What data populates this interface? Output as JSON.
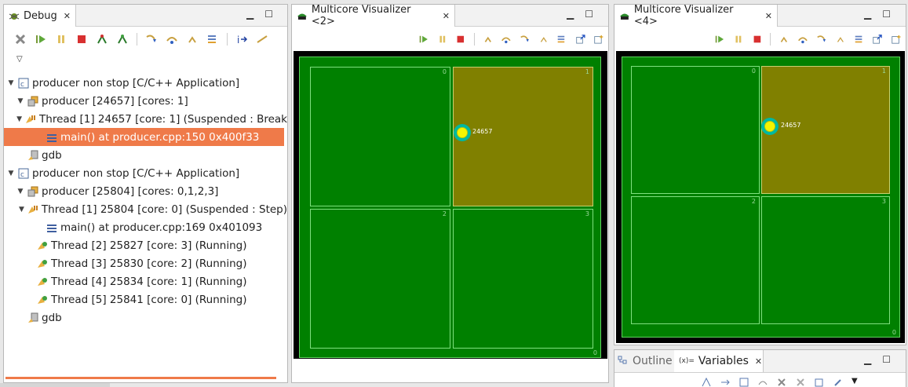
{
  "debug_view": {
    "tab_title": "Debug",
    "tree": [
      {
        "label": "producer non stop [C/C++ Application]",
        "icon": "launch-config-icon",
        "indent": 0,
        "twisty": "open"
      },
      {
        "label": "producer [24657] [cores: 1]",
        "icon": "process-icon",
        "indent": 1,
        "twisty": "open"
      },
      {
        "label": "Thread [1] 24657 [core: 1] (Suspended : Break",
        "icon": "thread-suspended-icon",
        "indent": 2,
        "twisty": "open"
      },
      {
        "label": "main() at producer.cpp:150 0x400f33",
        "icon": "stack-frame-icon",
        "indent": 3,
        "twisty": "none",
        "selected": true
      },
      {
        "label": "gdb",
        "icon": "gdb-icon",
        "indent": 1,
        "twisty": "none"
      },
      {
        "label": "producer non stop [C/C++ Application]",
        "icon": "launch-config-icon",
        "indent": 0,
        "twisty": "open"
      },
      {
        "label": "producer [25804] [cores: 0,1,2,3]",
        "icon": "process-icon",
        "indent": 1,
        "twisty": "open"
      },
      {
        "label": "Thread [1] 25804 [core: 0] (Suspended : Step)",
        "icon": "thread-suspended-icon",
        "indent": 2,
        "twisty": "open"
      },
      {
        "label": "main() at producer.cpp:169 0x401093",
        "icon": "stack-frame-icon",
        "indent": 3,
        "twisty": "none"
      },
      {
        "label": "Thread [2] 25827 [core: 3] (Running)",
        "icon": "thread-running-icon",
        "indent": 2,
        "twisty": "none"
      },
      {
        "label": "Thread [3] 25830 [core: 2] (Running)",
        "icon": "thread-running-icon",
        "indent": 2,
        "twisty": "none"
      },
      {
        "label": "Thread [4] 25834 [core: 1] (Running)",
        "icon": "thread-running-icon",
        "indent": 2,
        "twisty": "none"
      },
      {
        "label": "Thread [5] 25841 [core: 0] (Running)",
        "icon": "thread-running-icon",
        "indent": 2,
        "twisty": "none"
      },
      {
        "label": "gdb",
        "icon": "gdb-icon",
        "indent": 1,
        "twisty": "none"
      }
    ]
  },
  "visualizer_1": {
    "tab_title": "Multicore Visualizer <2>",
    "cpu_label": "0",
    "cores": [
      {
        "num": "0",
        "active": false
      },
      {
        "num": "1",
        "active": true
      },
      {
        "num": "2",
        "active": false
      },
      {
        "num": "3",
        "active": false
      }
    ],
    "thread_label": "24657"
  },
  "visualizer_2": {
    "tab_title": "Multicore Visualizer <4>",
    "cpu_label": "0",
    "cores": [
      {
        "num": "0",
        "active": false
      },
      {
        "num": "1",
        "active": true
      },
      {
        "num": "2",
        "active": false
      },
      {
        "num": "3",
        "active": false
      }
    ],
    "thread_label": "24657"
  },
  "bottom_panel": {
    "outline_tab": "Outline",
    "variables_tab": "Variables"
  },
  "colors": {
    "selection": "#ef7a49",
    "core_idle": "#008000",
    "core_active": "#808000",
    "thread": "#f5f500"
  }
}
